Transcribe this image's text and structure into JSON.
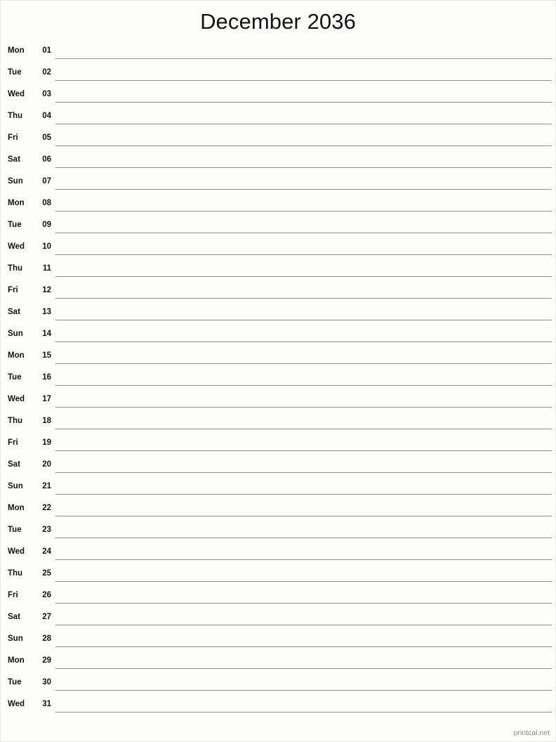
{
  "page": {
    "title": "December 2036",
    "month": "December",
    "year": "2036",
    "background_color": "#fdfdfa",
    "rule_color": "#8f8f8a",
    "text_color": "#121212"
  },
  "footer": {
    "brand": "printcal.net",
    "color": "#8a8a85"
  },
  "days": [
    {
      "weekday": "Mon",
      "date": "01"
    },
    {
      "weekday": "Tue",
      "date": "02"
    },
    {
      "weekday": "Wed",
      "date": "03"
    },
    {
      "weekday": "Thu",
      "date": "04"
    },
    {
      "weekday": "Fri",
      "date": "05"
    },
    {
      "weekday": "Sat",
      "date": "06"
    },
    {
      "weekday": "Sun",
      "date": "07"
    },
    {
      "weekday": "Mon",
      "date": "08"
    },
    {
      "weekday": "Tue",
      "date": "09"
    },
    {
      "weekday": "Wed",
      "date": "10"
    },
    {
      "weekday": "Thu",
      "date": "11"
    },
    {
      "weekday": "Fri",
      "date": "12"
    },
    {
      "weekday": "Sat",
      "date": "13"
    },
    {
      "weekday": "Sun",
      "date": "14"
    },
    {
      "weekday": "Mon",
      "date": "15"
    },
    {
      "weekday": "Tue",
      "date": "16"
    },
    {
      "weekday": "Wed",
      "date": "17"
    },
    {
      "weekday": "Thu",
      "date": "18"
    },
    {
      "weekday": "Fri",
      "date": "19"
    },
    {
      "weekday": "Sat",
      "date": "20"
    },
    {
      "weekday": "Sun",
      "date": "21"
    },
    {
      "weekday": "Mon",
      "date": "22"
    },
    {
      "weekday": "Tue",
      "date": "23"
    },
    {
      "weekday": "Wed",
      "date": "24"
    },
    {
      "weekday": "Thu",
      "date": "25"
    },
    {
      "weekday": "Fri",
      "date": "26"
    },
    {
      "weekday": "Sat",
      "date": "27"
    },
    {
      "weekday": "Sun",
      "date": "28"
    },
    {
      "weekday": "Mon",
      "date": "29"
    },
    {
      "weekday": "Tue",
      "date": "30"
    },
    {
      "weekday": "Wed",
      "date": "31"
    }
  ]
}
